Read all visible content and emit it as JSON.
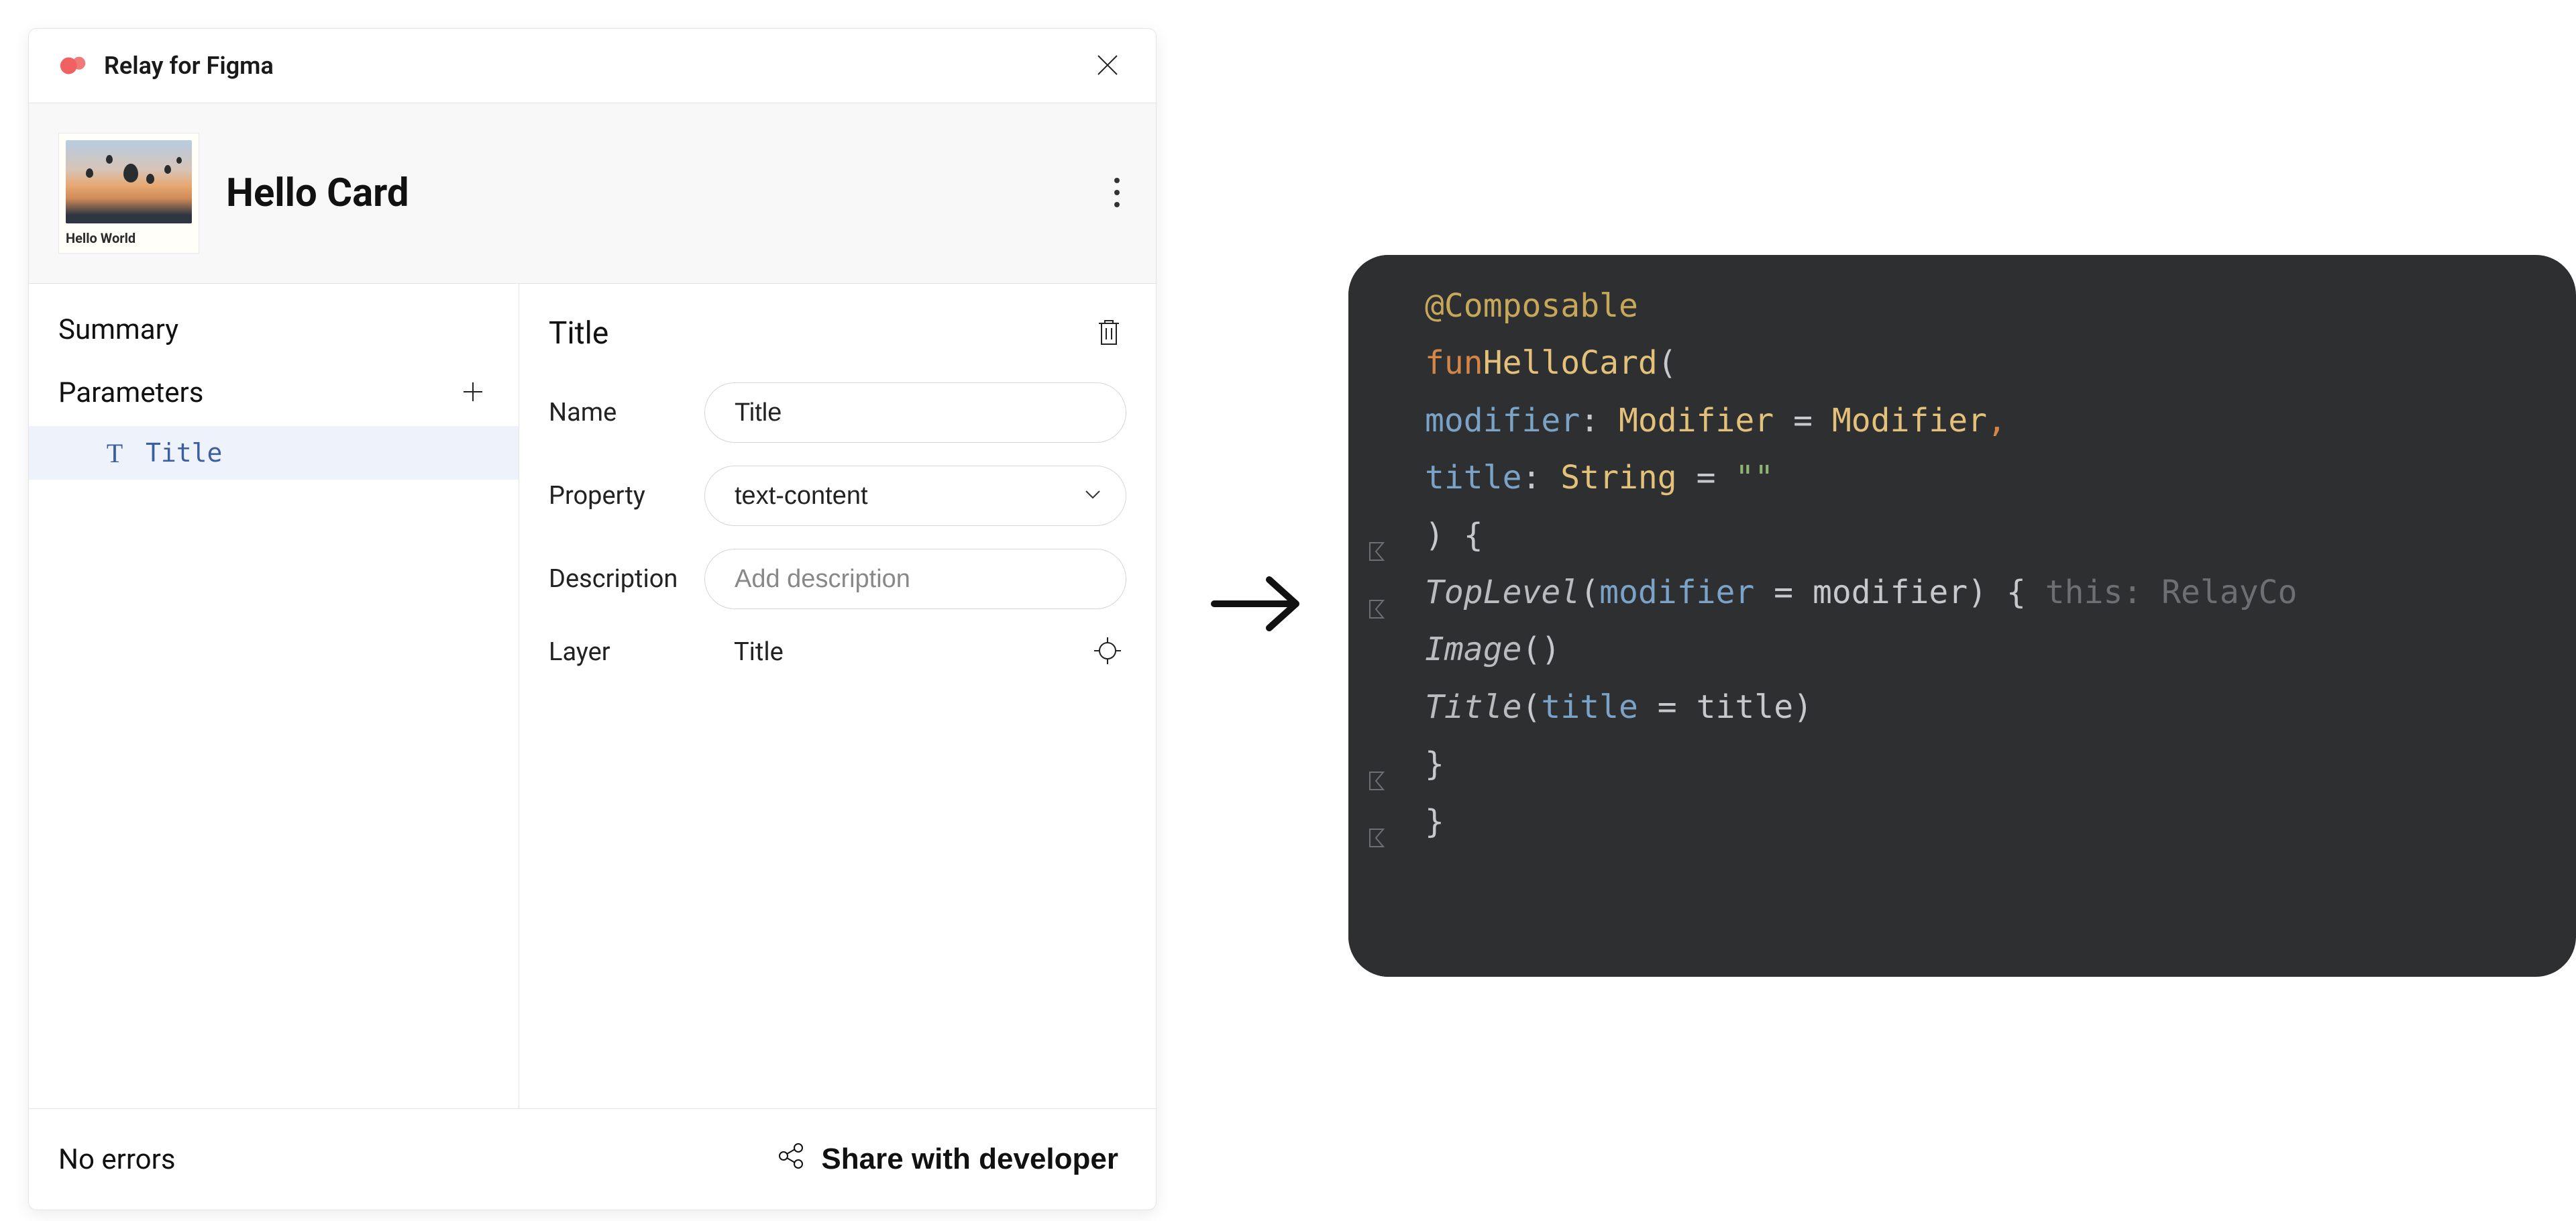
{
  "plugin": {
    "brand": "Relay for Figma",
    "card": {
      "title": "Hello Card",
      "thumb_label": "Hello World"
    },
    "sidebar": {
      "summary_label": "Summary",
      "params_label": "Parameters",
      "params": [
        {
          "name": "Title"
        }
      ]
    },
    "details": {
      "section_title": "Title",
      "fields": {
        "name_label": "Name",
        "name_value": "Title",
        "property_label": "Property",
        "property_value": "text-content",
        "description_label": "Description",
        "description_placeholder": "Add description",
        "layer_label": "Layer",
        "layer_value": "Title"
      }
    },
    "footer": {
      "status": "No errors",
      "share_label": "Share with developer"
    }
  },
  "code": {
    "annotation": "@Composable",
    "fun_kw": "fun",
    "fn_name": "HelloCard",
    "param1_name": "modifier",
    "param1_type": "Modifier",
    "param1_default": "Modifier",
    "param2_name": "title",
    "param2_type": "String",
    "param2_default": "\"\"",
    "call_toplevel": "TopLevel",
    "arg_modifier": "modifier",
    "hint_text": "this: RelayCo",
    "call_image": "Image",
    "call_title": "Title",
    "arg_title": "title"
  }
}
